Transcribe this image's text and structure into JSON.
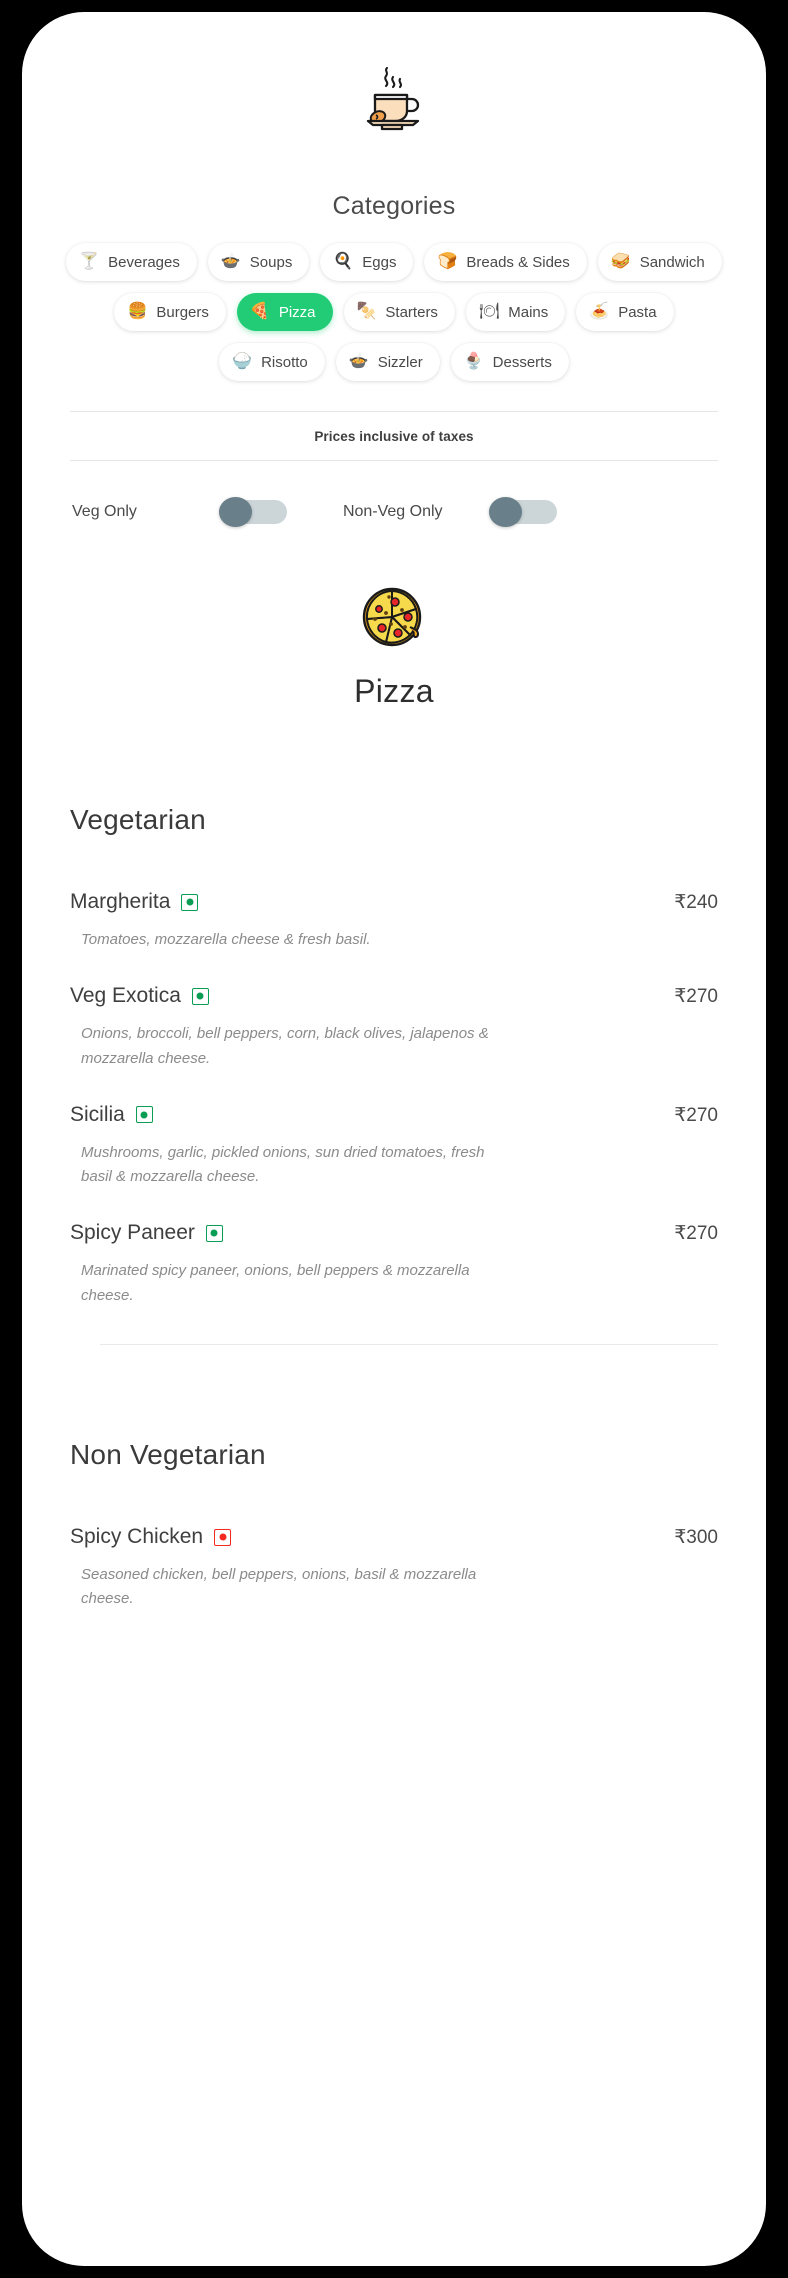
{
  "brand": {
    "logo_icon": "coffee-cup-icon"
  },
  "categories": {
    "title": "Categories",
    "items": [
      {
        "label": "Beverages",
        "icon": "cocktail-glass-icon",
        "active": false
      },
      {
        "label": "Soups",
        "icon": "soup-bowl-icon",
        "active": false
      },
      {
        "label": "Eggs",
        "icon": "fried-egg-icon",
        "active": false
      },
      {
        "label": "Breads & Sides",
        "icon": "bread-loaf-icon",
        "active": false
      },
      {
        "label": "Sandwich",
        "icon": "sandwich-icon",
        "active": false
      },
      {
        "label": "Burgers",
        "icon": "burger-icon",
        "active": false
      },
      {
        "label": "Pizza",
        "icon": "pizza-icon",
        "active": true
      },
      {
        "label": "Starters",
        "icon": "skewer-icon",
        "active": false
      },
      {
        "label": "Mains",
        "icon": "cloche-icon",
        "active": false
      },
      {
        "label": "Pasta",
        "icon": "pasta-bowl-icon",
        "active": false
      },
      {
        "label": "Risotto",
        "icon": "risotto-bowl-icon",
        "active": false
      },
      {
        "label": "Sizzler",
        "icon": "sizzler-plate-icon",
        "active": false
      },
      {
        "label": "Desserts",
        "icon": "ice-cream-icon",
        "active": false
      }
    ]
  },
  "tax_note": "Prices inclusive of taxes",
  "filters": [
    {
      "label": "Veg Only",
      "state": "off"
    },
    {
      "label": "Non-Veg Only",
      "state": "off"
    }
  ],
  "hero": {
    "icon": "pizza-icon",
    "title": "Pizza"
  },
  "menu": {
    "sections": [
      {
        "title": "Vegetarian",
        "items": [
          {
            "name": "Margherita",
            "diet": "veg",
            "price": "₹240",
            "description": "Tomatoes, mozzarella cheese & fresh basil."
          },
          {
            "name": "Veg Exotica",
            "diet": "veg",
            "price": "₹270",
            "description": "Onions, broccoli, bell peppers, corn, black olives, jalapenos & mozzarella cheese."
          },
          {
            "name": "Sicilia",
            "diet": "veg",
            "price": "₹270",
            "description": "Mushrooms, garlic, pickled onions, sun dried tomatoes, fresh basil & mozzarella cheese."
          },
          {
            "name": "Spicy Paneer",
            "diet": "veg",
            "price": "₹270",
            "description": "Marinated spicy paneer, onions, bell peppers & mozzarella cheese."
          }
        ]
      },
      {
        "title": "Non Vegetarian",
        "items": [
          {
            "name": "Spicy Chicken",
            "diet": "nonveg",
            "price": "₹300",
            "description": "Seasoned chicken, bell peppers, onions, basil & mozzarella cheese."
          }
        ]
      }
    ]
  },
  "colors": {
    "active_chip": "#22cc77",
    "veg_badge": "#0a9d54",
    "nonveg_badge": "#f5291f",
    "toggle_knob": "#69808a",
    "toggle_track": "#ccd6d8"
  }
}
